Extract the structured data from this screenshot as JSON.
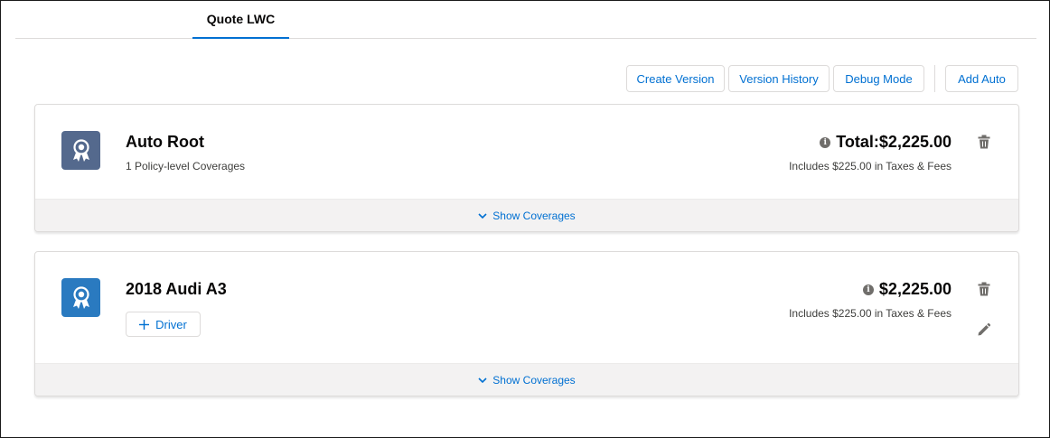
{
  "tabs": [
    {
      "label": "Quote LWC",
      "active": true
    }
  ],
  "toolbar": {
    "create_version": "Create Version",
    "version_history": "Version History",
    "debug_mode": "Debug Mode",
    "add_auto": "Add Auto"
  },
  "cards": [
    {
      "title": "Auto Root",
      "subtitle": "1 Policy-level Coverages",
      "total": "Total:$2,225.00",
      "fees": "Includes $225.00 in Taxes & Fees",
      "show_coverages": "Show Coverages",
      "icon": "award-ribbon-icon",
      "icon_color": "#54698d"
    },
    {
      "title": "2018 Audi A3",
      "add_driver": "Driver",
      "total": "$2,225.00",
      "fees": "Includes $225.00 in Taxes & Fees",
      "show_coverages": "Show Coverages",
      "icon": "award-ribbon-icon",
      "icon_color": "#2a7ac0"
    }
  ],
  "colors": {
    "accent": "#0070d2",
    "footer_bg": "#f3f2f2"
  }
}
